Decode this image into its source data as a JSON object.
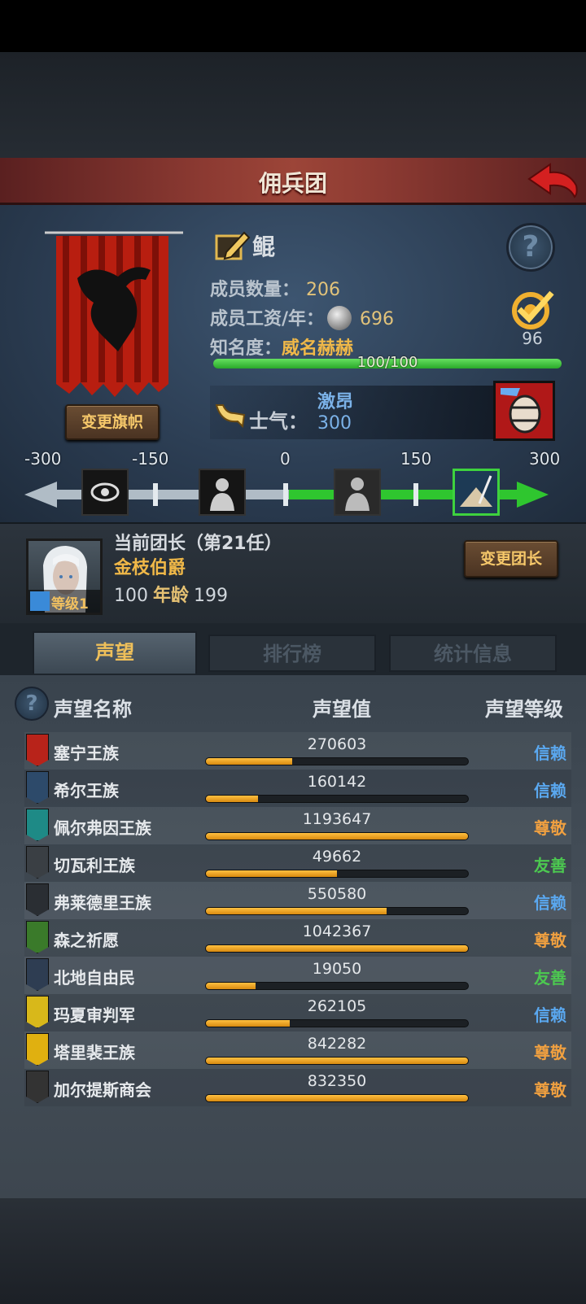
{
  "title": "佣兵团",
  "clan": {
    "name": "鲲",
    "member_count_label": "成员数量：",
    "member_count": "206",
    "wage_label": "成员工资/年：",
    "wage": "696",
    "fame_label": "知名度：",
    "fame_value": "威名赫赫",
    "fame_progress_text": "100/100",
    "fame_progress": 1.0,
    "target_count": "96",
    "change_banner_label": "变更旗帜"
  },
  "morale": {
    "label": "士气：",
    "state": "激昂",
    "value": "300",
    "scale_ticks": [
      "-300",
      "-150",
      "0",
      "150",
      "300"
    ]
  },
  "leader": {
    "title": "当前团长（第21任）",
    "name": "金枝伯爵",
    "level_text": "等级1",
    "stat_value": "100",
    "age_label": "年龄",
    "age": "199",
    "change_leader_label": "变更团长"
  },
  "tabs": [
    {
      "label": "声望",
      "active": true
    },
    {
      "label": "排行榜",
      "active": false
    },
    {
      "label": "统计信息",
      "active": false
    }
  ],
  "reputation": {
    "headers": {
      "name": "声望名称",
      "value": "声望值",
      "level": "声望等级"
    },
    "rows": [
      {
        "name": "塞宁王族",
        "value": "270603",
        "fill": 0.33,
        "level": "信赖",
        "level_color": "#5aa8f0",
        "icon_color": "#b8231a"
      },
      {
        "name": "希尔王族",
        "value": "160142",
        "fill": 0.2,
        "level": "信赖",
        "level_color": "#5aa8f0",
        "icon_color": "#2d4a6a"
      },
      {
        "name": "佩尔弗因王族",
        "value": "1193647",
        "fill": 1.0,
        "level": "尊敬",
        "level_color": "#f0a040",
        "icon_color": "#1e8a86"
      },
      {
        "name": "切瓦利王族",
        "value": "49662",
        "fill": 0.5,
        "level": "友善",
        "level_color": "#4cc850",
        "icon_color": "#3a3f44"
      },
      {
        "name": "弗莱德里王族",
        "value": "550580",
        "fill": 0.69,
        "level": "信赖",
        "level_color": "#5aa8f0",
        "icon_color": "#2a2e33"
      },
      {
        "name": "森之祈愿",
        "value": "1042367",
        "fill": 1.0,
        "level": "尊敬",
        "level_color": "#f0a040",
        "icon_color": "#3a7a2a"
      },
      {
        "name": "北地自由民",
        "value": "19050",
        "fill": 0.19,
        "level": "友善",
        "level_color": "#4cc850",
        "icon_color": "#2e3d52"
      },
      {
        "name": "玛夏审判军",
        "value": "262105",
        "fill": 0.32,
        "level": "信赖",
        "level_color": "#5aa8f0",
        "icon_color": "#d8b81a"
      },
      {
        "name": "塔里裴王族",
        "value": "842282",
        "fill": 1.0,
        "level": "尊敬",
        "level_color": "#f0a040",
        "icon_color": "#e0b010"
      },
      {
        "name": "加尔提斯商会",
        "value": "832350",
        "fill": 1.0,
        "level": "尊敬",
        "level_color": "#f0a040",
        "icon_color": "#333333"
      }
    ]
  }
}
